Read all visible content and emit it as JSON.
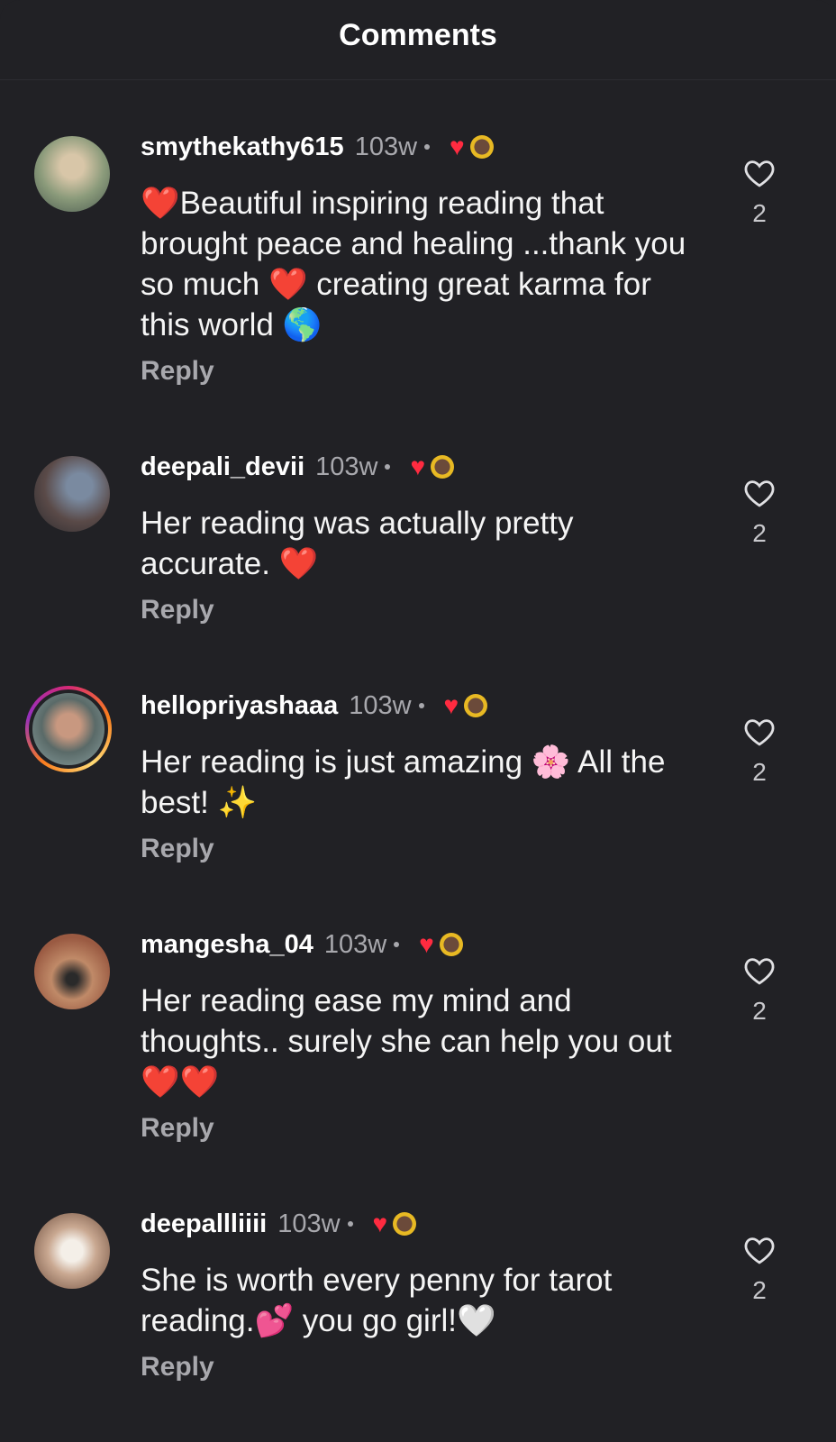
{
  "header": {
    "title": "Comments"
  },
  "comments": [
    {
      "user": "smythekathy615",
      "time": "103w",
      "text": "❤️Beautiful inspiring reading that brought peace and healing ...thank you so much ❤️ creating great karma for this world 🌎",
      "reply": "Reply",
      "likes": "2",
      "avatar_color": "#8a9a7a",
      "story_ring": false
    },
    {
      "user": "deepali_devii",
      "time": "103w",
      "text": "Her reading was actually pretty accurate. ❤️",
      "reply": "Reply",
      "likes": "2",
      "avatar_color": "#5a4a48",
      "story_ring": false
    },
    {
      "user": "hellopriyashaaa",
      "time": "103w",
      "text": "Her reading is just amazing 🌸 All the best! ✨",
      "reply": "Reply",
      "likes": "2",
      "avatar_color": "#7a8a88",
      "story_ring": true
    },
    {
      "user": "mangesha_04",
      "time": "103w",
      "text": "Her reading ease my mind and thoughts.. surely she can help you out ❤️❤️",
      "reply": "Reply",
      "likes": "2",
      "avatar_color": "#9a5a42",
      "story_ring": false
    },
    {
      "user": "deepallliiii",
      "time": "103w",
      "text": "She is worth every penny for tarot reading.💕 you go girl!🤍",
      "reply": "Reply",
      "likes": "2",
      "avatar_color": "#c9a891",
      "story_ring": false
    }
  ]
}
